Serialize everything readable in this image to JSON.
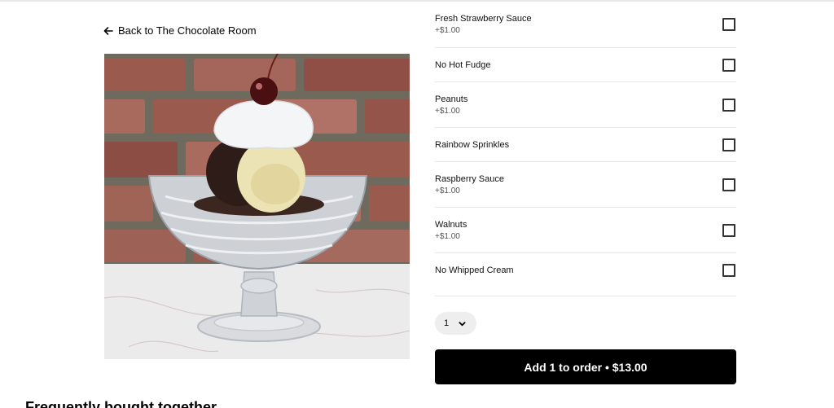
{
  "back_link": {
    "label": "Back to The Chocolate Room"
  },
  "product_image": {
    "alt": "Hot fudge sundae with whipped cream and a cherry in a glass dish"
  },
  "options": [
    {
      "label": "Fresh Strawberry Sauce",
      "price": "+$1.00",
      "checked": false
    },
    {
      "label": "No Hot Fudge",
      "price": "",
      "checked": false
    },
    {
      "label": "Peanuts",
      "price": "+$1.00",
      "checked": false
    },
    {
      "label": "Rainbow Sprinkles",
      "price": "",
      "checked": false
    },
    {
      "label": "Raspberry Sauce",
      "price": "+$1.00",
      "checked": false
    },
    {
      "label": "Walnuts",
      "price": "+$1.00",
      "checked": false
    },
    {
      "label": "No Whipped Cream",
      "price": "",
      "checked": false
    }
  ],
  "quantity": {
    "value": "1"
  },
  "add_button": {
    "label": "Add 1 to order • $13.00"
  },
  "section_heading": "Frequently bought together"
}
